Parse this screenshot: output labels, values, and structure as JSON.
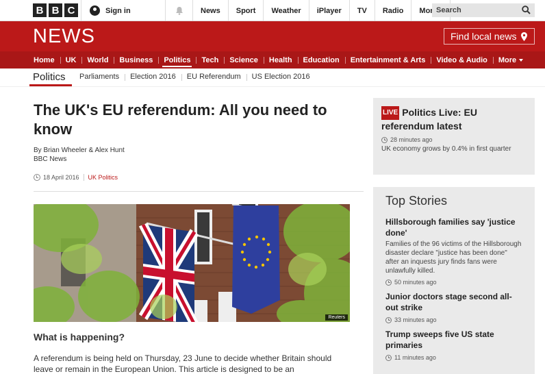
{
  "topbar": {
    "logo_letters": [
      "B",
      "B",
      "C"
    ],
    "signin_label": "Sign in",
    "nav": [
      "News",
      "Sport",
      "Weather",
      "iPlayer",
      "TV",
      "Radio"
    ],
    "more_label": "More",
    "search_placeholder": "Search"
  },
  "newsbar": {
    "logo": "NEWS",
    "find_local": "Find local news"
  },
  "section_nav": {
    "items": [
      "Home",
      "UK",
      "World",
      "Business",
      "Politics",
      "Tech",
      "Science",
      "Health",
      "Education",
      "Entertainment & Arts",
      "Video & Audio"
    ],
    "more_label": "More",
    "active": "Politics"
  },
  "sub_nav": {
    "title": "Politics",
    "items": [
      "Parliaments",
      "Election 2016",
      "EU Referendum",
      "US Election 2016"
    ]
  },
  "article": {
    "headline": "The UK's EU referendum: All you need to know",
    "author": "By Brian Wheeler & Alex Hunt",
    "source": "BBC News",
    "date": "18 April 2016",
    "topic": "UK Politics",
    "image_credit": "Reuters",
    "subheading": "What is happening?",
    "paragraph": "A referendum is being held on Thursday, 23 June to decide whether Britain should leave or remain in the European Union. This article is designed to be an"
  },
  "sidebar": {
    "live": {
      "badge": "LIVE",
      "title": "Politics Live: EU referendum latest",
      "time": "28 minutes ago",
      "summary": "UK economy grows by 0.4% in first quarter"
    },
    "top_stories": {
      "heading": "Top Stories",
      "stories": [
        {
          "title": "Hillsborough families say 'justice done'",
          "summary": "Families of the 96 victims of the Hillsborough disaster declare \"justice has been done\" after an inquests jury finds fans were unlawfully killed.",
          "time": "50 minutes ago"
        },
        {
          "title": "Junior doctors stage second all-out strike",
          "summary": "",
          "time": "33 minutes ago"
        },
        {
          "title": "Trump sweeps five US state primaries",
          "summary": "",
          "time": "11 minutes ago"
        }
      ]
    }
  },
  "colors": {
    "brand_red": "#bb1919",
    "nav_red": "#a91717",
    "sidebar_bg": "#eaeaea"
  }
}
